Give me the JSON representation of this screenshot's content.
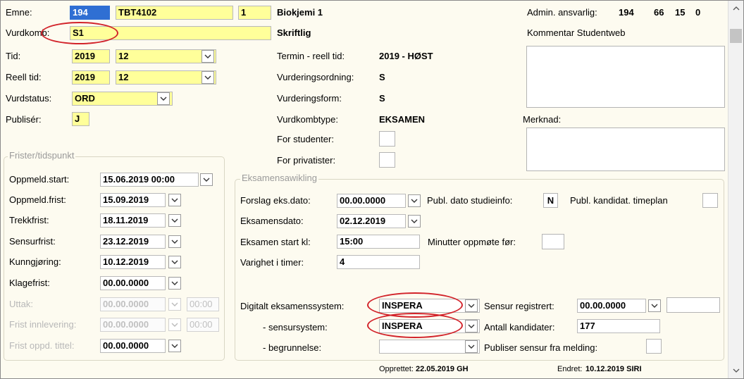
{
  "header": {
    "emne_label": "Emne:",
    "emne_code": "194",
    "emne_id": "TBT4102",
    "emne_ver": "1",
    "emne_name": "Biokjemi 1",
    "admin_label": "Admin. ansvarlig:",
    "admin_values": [
      "194",
      "66",
      "15",
      "0"
    ],
    "vurdkomb_label": "Vurdkomb:",
    "vurdkomb_value": "S1",
    "vurdkomb_name": "Skriftlig",
    "kommentar_label": "Kommentar Studentweb"
  },
  "left": {
    "tid_label": "Tid:",
    "tid_year": "2019",
    "tid_month": "12",
    "reell_label": "Reell tid:",
    "reell_year": "2019",
    "reell_month": "12",
    "status_label": "Vurdstatus:",
    "status_value": "ORD",
    "publiser_label": "Publisér:",
    "publiser_value": "J"
  },
  "mid": {
    "termin_label": "Termin - reell tid:",
    "termin_value": "2019  - HØST",
    "ordning_label": "Vurderingsordning:",
    "ordning_value": "S",
    "form_label": "Vurderingsform:",
    "form_value": "S",
    "kombtype_label": "Vurdkombtype:",
    "kombtype_value": "EKSAMEN",
    "stud_label": "For studenter:",
    "priv_label": "For privatister:",
    "merknad_label": "Merknad:"
  },
  "frister": {
    "title": "Frister/tidspunkt",
    "rows": [
      {
        "label": "Oppmeld.start:",
        "value": "15.06.2019 00:00",
        "disabled": false
      },
      {
        "label": "Oppmeld.frist:",
        "value": "15.09.2019",
        "disabled": false
      },
      {
        "label": "Trekkfrist:",
        "value": "18.11.2019",
        "disabled": false
      },
      {
        "label": "Sensurfrist:",
        "value": "23.12.2019",
        "disabled": false
      },
      {
        "label": "Kunngjøring:",
        "value": "10.12.2019",
        "disabled": false
      },
      {
        "label": "Klagefrist:",
        "value": "00.00.0000",
        "disabled": false
      },
      {
        "label": "Uttak:",
        "value": "00.00.0000",
        "time": "00:00",
        "disabled": true
      },
      {
        "label": "Frist innlevering:",
        "value": "00.00.0000",
        "time": "00:00",
        "disabled": true
      },
      {
        "label": "Frist oppd. tittel:",
        "value": "00.00.0000",
        "disabled": false
      }
    ]
  },
  "eksamen": {
    "title": "Eksamensawikling",
    "forslag_label": "Forslag eks.dato:",
    "forslag_value": "00.00.0000",
    "publ_label": "Publ. dato studieinfo:",
    "publ_value": "N",
    "publ_kand_label": "Publ. kandidat. timeplan",
    "dato_label": "Eksamensdato:",
    "dato_value": "02.12.2019",
    "start_label": "Eksamen start kl:",
    "start_value": "15:00",
    "minutter_label": "Minutter oppmøte før:",
    "varighet_label": "Varighet i timer:",
    "varighet_value": "4",
    "digital_label": "Digitalt eksamenssystem:",
    "digital_value": "INSPERA",
    "sensur_reg_label": "Sensur registrert:",
    "sensur_reg_value": "00.00.0000",
    "sensursystem_label": "- sensursystem:",
    "sensursystem_value": "INSPERA",
    "antall_label": "Antall kandidater:",
    "antall_value": "177",
    "begrunnelse_label": "- begrunnelse:",
    "publiser_sensur_label": "Publiser sensur fra melding:"
  },
  "footer": {
    "opprettet_label": "Opprettet:",
    "opprettet_value": "22.05.2019  GH",
    "endret_label": "Endret:",
    "endret_value": "10.12.2019  SIRI"
  },
  "colors": {
    "highlight_yellow": "#ffff9a",
    "selected_blue": "#2f6fd3",
    "annotation_red": "#d2232a",
    "background": "#fdfbf0"
  }
}
